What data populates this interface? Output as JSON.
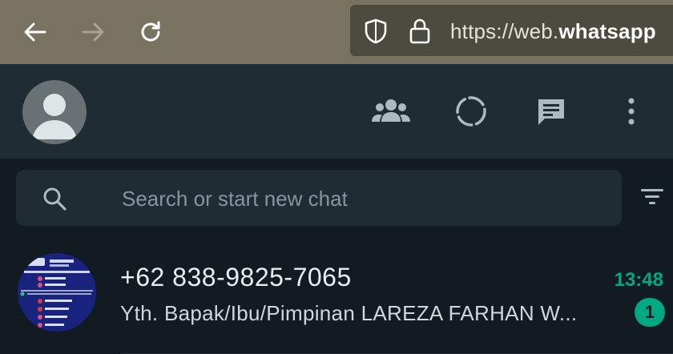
{
  "browser": {
    "url_prefix": "https://web.",
    "url_host": "whatsapp"
  },
  "header": {
    "icons": [
      "communities-icon",
      "status-icon",
      "new-chat-icon",
      "menu-icon"
    ]
  },
  "search": {
    "placeholder": "Search or start new chat"
  },
  "chats": [
    {
      "name": "+62 838-9825-7065",
      "time": "13:48",
      "message": "Yth. Bapak/Ibu/Pimpinan LAREZA FARHAN W...",
      "unread": "1"
    }
  ],
  "colors": {
    "browser_bar": "#787260",
    "header_bg": "#202c33",
    "app_bg": "#111b21",
    "accent": "#00a884"
  }
}
